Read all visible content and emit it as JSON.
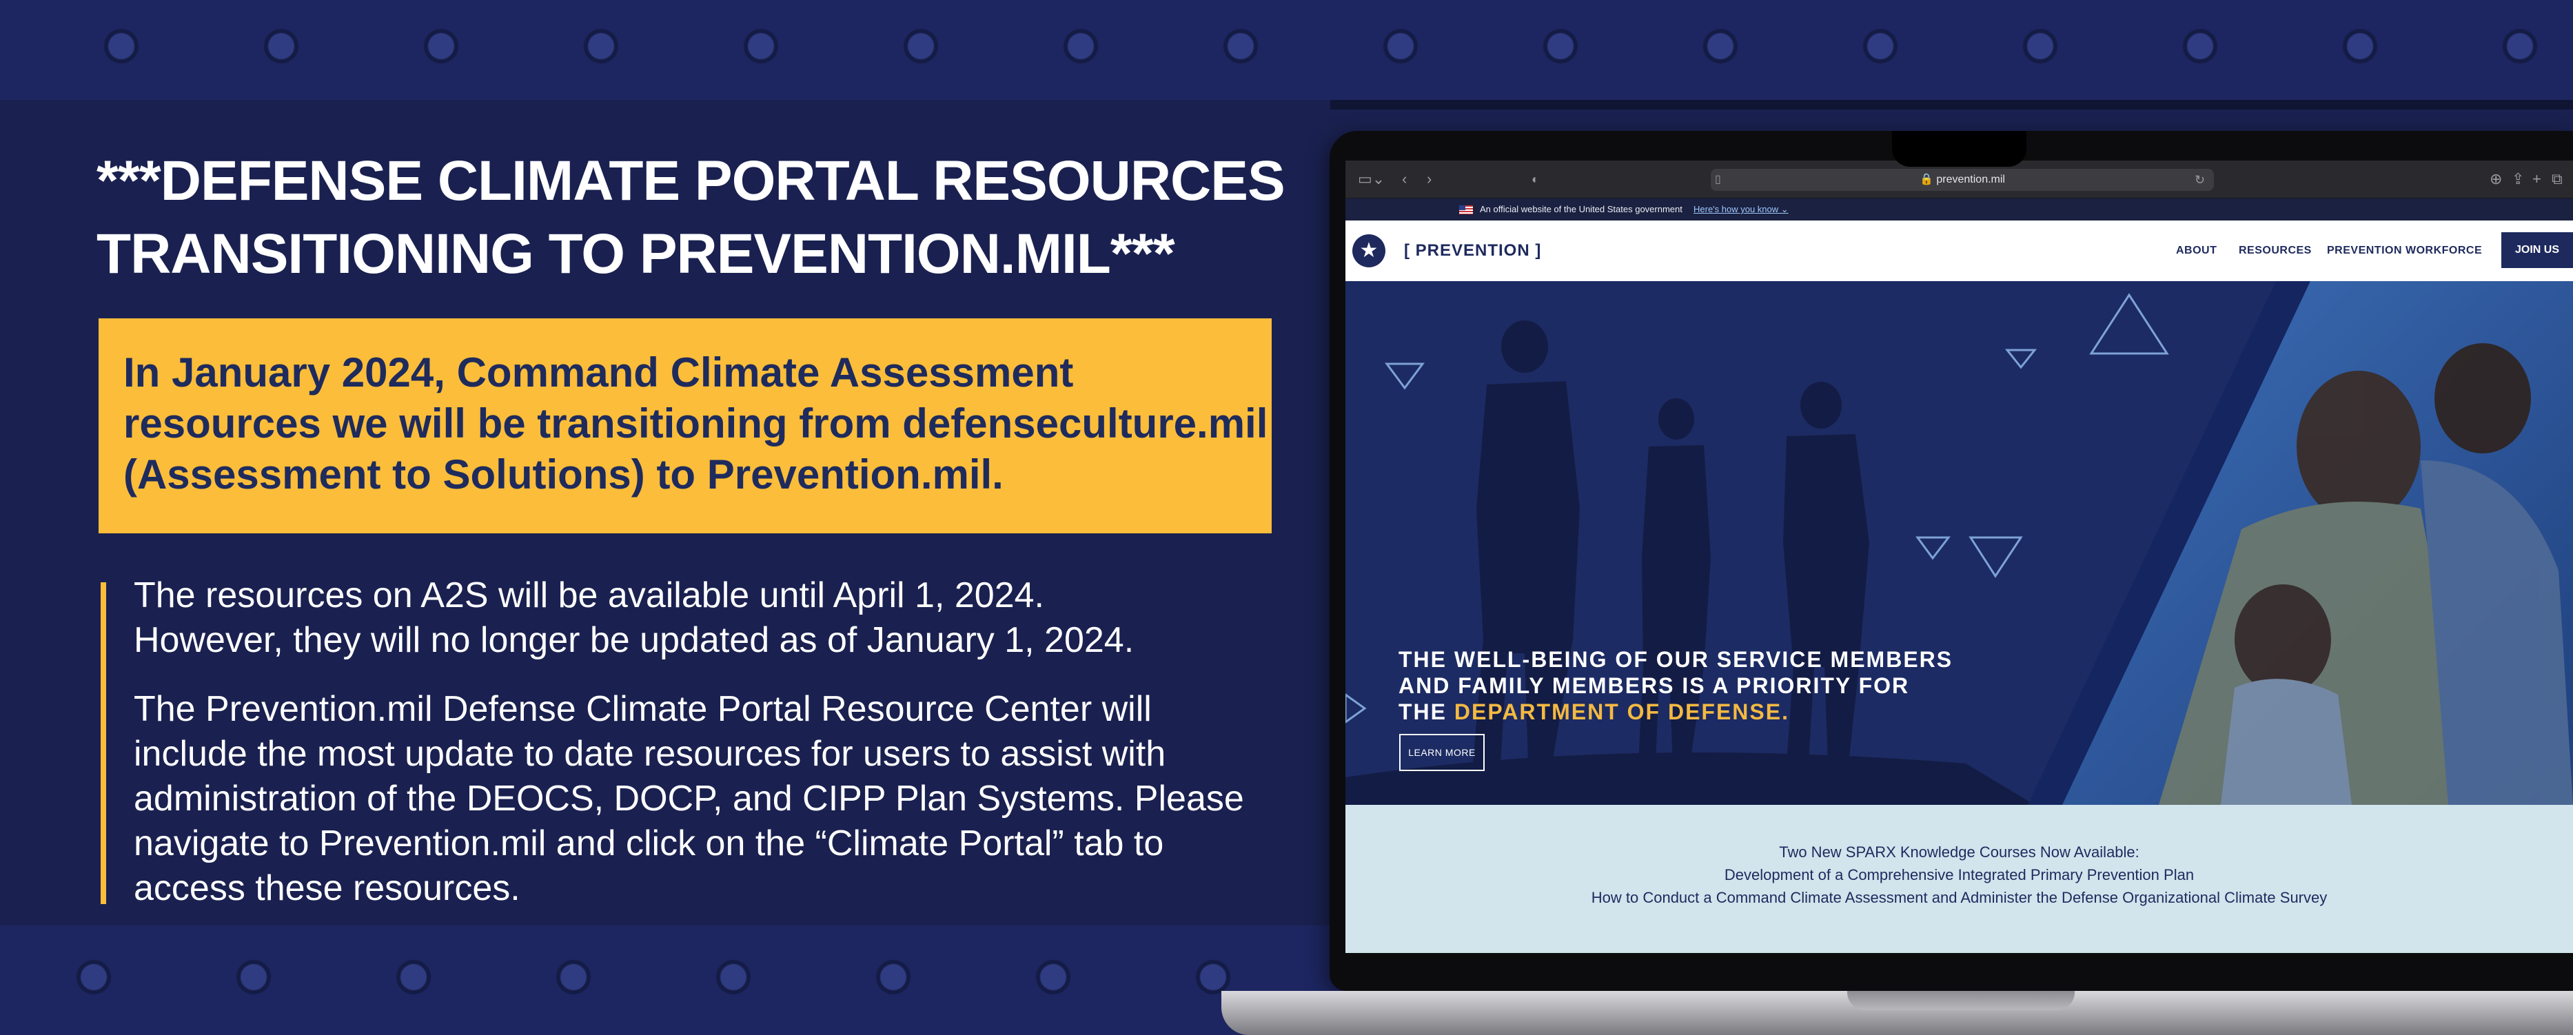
{
  "headline": {
    "line1": "***DEFENSE CLIMATE PORTAL RESOURCES",
    "line2": "TRANSITIONING TO PREVENTION.MIL***"
  },
  "callout": {
    "line1": "In January 2024, Command Climate Assessment",
    "line2": "resources we will be transitioning from defenseculture.mil",
    "line3": "(Assessment to Solutions) to Prevention.mil."
  },
  "body": {
    "p1_line1": "The resources on A2S will be available until April 1, 2024.",
    "p1_line2": "However, they will no longer be updated as of January 1, 2024.",
    "p2_line1": "The Prevention.mil Defense Climate Portal Resource Center will",
    "p2_line2": "include the most update to date resources for users to assist with",
    "p2_line3": "administration of the DEOCS, DOCP, and CIPP Plan Systems. Please",
    "p2_line4": "navigate to Prevention.mil and click on the “Climate Portal” tab to",
    "p2_line5": "access these resources."
  },
  "browser": {
    "url": "🔒 prevention.mil"
  },
  "gov_banner": {
    "text": "An official website of the United States government",
    "link": "Here's how you know ⌄"
  },
  "site": {
    "name": "[ PREVENTION ]",
    "nav": [
      "ABOUT",
      "RESOURCES",
      "PREVENTION WORKFORCE"
    ],
    "join": "JOIN US"
  },
  "hero": {
    "line1": "THE WELL-BEING OF OUR SERVICE MEMBERS",
    "line2": "AND FAMILY MEMBERS IS A PRIORITY FOR",
    "line3_prefix": "THE ",
    "line3_highlight": "DEPARTMENT OF DEFENSE",
    "line3_suffix": ".",
    "button": "LEARN MORE"
  },
  "announcement": {
    "line1": "Two New SPARX Knowledge Courses Now Available:",
    "line2": "Development of a Comprehensive Integrated Primary Prevention Plan",
    "line3": "How to Conduct a Command Climate Assessment and Administer the Defense Organizational Climate Survey"
  },
  "colors": {
    "background": "#1a2150",
    "accent": "#fbbd3a",
    "callout_text": "#1e2b5c",
    "hero_highlight": "#f4b942"
  }
}
